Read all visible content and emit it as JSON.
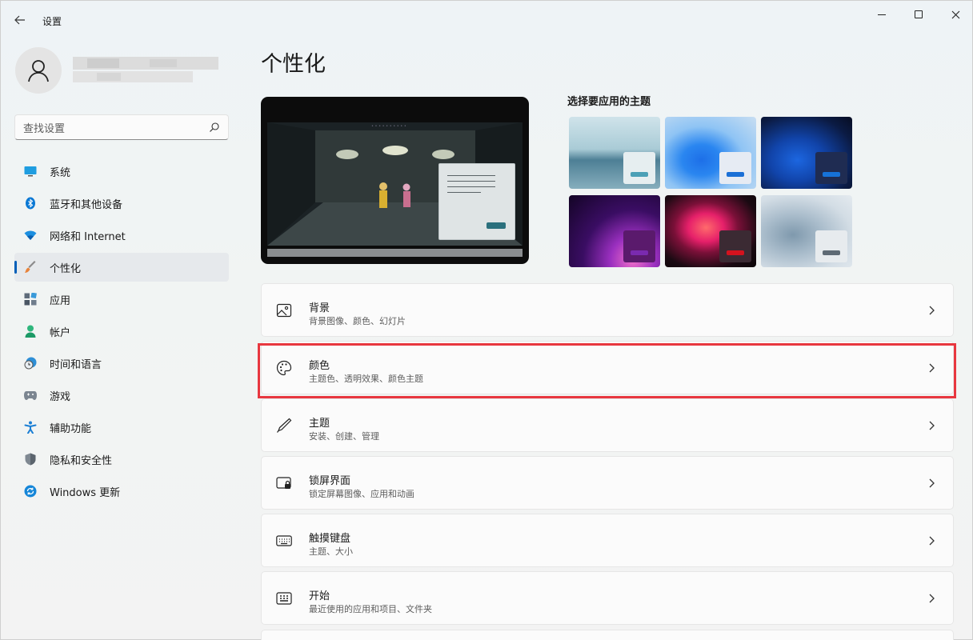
{
  "app": {
    "title": "设置"
  },
  "search": {
    "placeholder": "查找设置"
  },
  "sidebar": {
    "items": [
      {
        "label": "系统",
        "icon": "monitor-icon"
      },
      {
        "label": "蓝牙和其他设备",
        "icon": "bluetooth-icon"
      },
      {
        "label": "网络和 Internet",
        "icon": "wifi-icon"
      },
      {
        "label": "个性化",
        "icon": "brush-icon",
        "active": true
      },
      {
        "label": "应用",
        "icon": "apps-icon"
      },
      {
        "label": "帐户",
        "icon": "person-icon"
      },
      {
        "label": "时间和语言",
        "icon": "clock-globe-icon"
      },
      {
        "label": "游戏",
        "icon": "gamepad-icon"
      },
      {
        "label": "辅助功能",
        "icon": "accessibility-icon"
      },
      {
        "label": "隐私和安全性",
        "icon": "shield-icon"
      },
      {
        "label": "Windows 更新",
        "icon": "update-icon"
      }
    ]
  },
  "main": {
    "title": "个性化",
    "themes_label": "选择要应用的主题",
    "cards": [
      {
        "title": "背景",
        "subtitle": "背景图像、颜色、幻灯片",
        "icon": "image-icon"
      },
      {
        "title": "颜色",
        "subtitle": "主题色、透明效果、颜色主题",
        "icon": "palette-icon",
        "highlighted": true
      },
      {
        "title": "主题",
        "subtitle": "安装、创建、管理",
        "icon": "pen-icon"
      },
      {
        "title": "锁屏界面",
        "subtitle": "锁定屏幕图像、应用和动画",
        "icon": "lock-screen-icon"
      },
      {
        "title": "触摸键盘",
        "subtitle": "主题、大小",
        "icon": "keyboard-icon"
      },
      {
        "title": "开始",
        "subtitle": "最近使用的应用和项目、文件夹",
        "icon": "start-menu-icon"
      }
    ]
  },
  "colors": {
    "accent": "#005fb8",
    "highlight_border": "#e8373f"
  }
}
